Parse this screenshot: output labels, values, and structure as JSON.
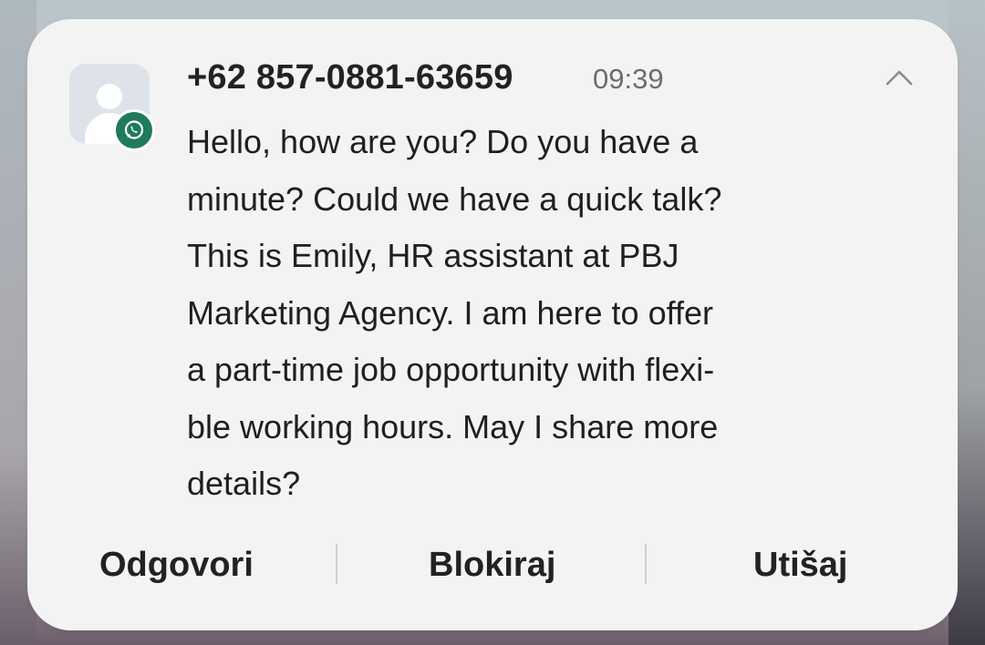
{
  "notification": {
    "sender": "+62 857-0881-63659",
    "time": "09:39",
    "message": "Hello, how are you? Do you have a\nminute? Could we have a quick talk?\nThis is Emily, HR assistant at PBJ\nMarketing Agency. I am here to offer\na part-time job opportunity with flexi-\nble working hours. May I share more\ndetails?",
    "app_icon": "whatsapp-icon",
    "avatar_icon": "contact-avatar-icon",
    "collapse_icon": "chevron-up-icon"
  },
  "actions": {
    "reply": "Odgovori",
    "block": "Blokiraj",
    "mute": "Utišaj"
  },
  "colors": {
    "card_background": "#f3f3f4",
    "app_badge": "#1f7a5e",
    "avatar_background": "#dde3e8",
    "primary_text": "#222222",
    "secondary_text": "#6d6d6d"
  }
}
